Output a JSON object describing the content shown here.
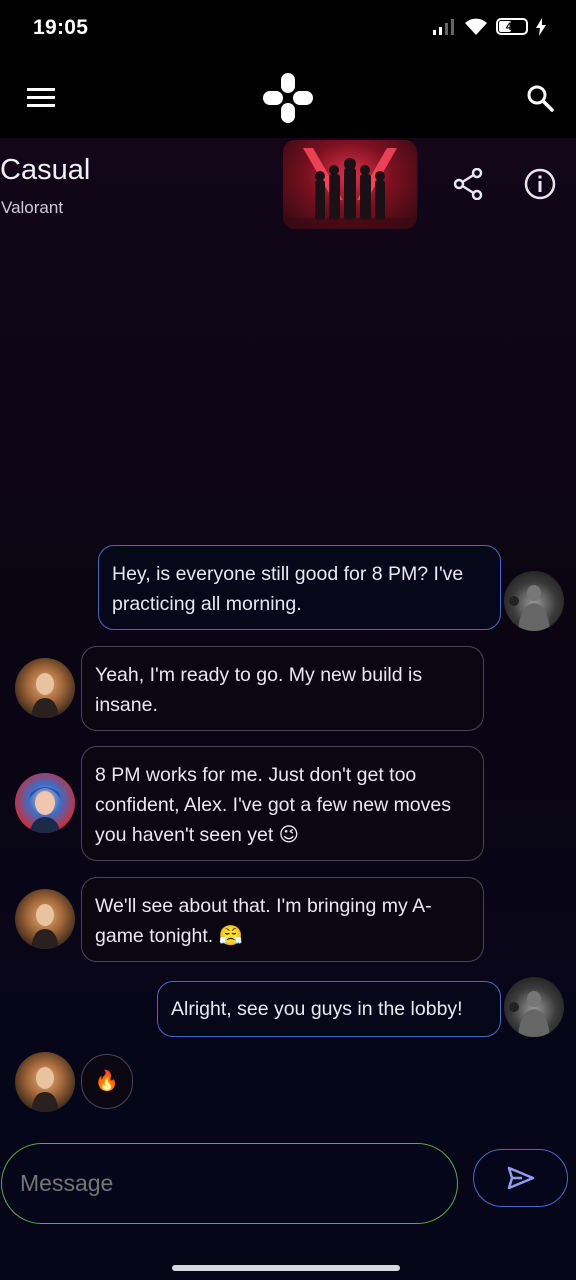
{
  "status_bar": {
    "time": "19:05",
    "battery": "43",
    "icons": [
      "signal-icon",
      "wifi-icon",
      "battery-icon",
      "charging-icon"
    ]
  },
  "app_bar": {
    "left_icon": "menu-icon",
    "center_icon": "gamepad-logo-icon",
    "right_icon": "search-icon"
  },
  "chat_header": {
    "title": "Casual",
    "subtitle": "Valorant",
    "actions": [
      "share-icon",
      "info-icon"
    ]
  },
  "messages": [
    {
      "sender": "me",
      "text": "Hey, is everyone still good for 8 PM? I've practicing all morning."
    },
    {
      "sender": "player-1",
      "text": "Yeah, I'm ready to go. My new build is insane."
    },
    {
      "sender": "player-2",
      "text": "8 PM works for me. Just don't get too confident, Alex. I've got a few new moves you haven't seen yet 😉"
    },
    {
      "sender": "player-1",
      "text": "We'll see about that. I'm bringing my A-game tonight. 😤"
    },
    {
      "sender": "me",
      "text": "Alright, see you guys in the lobby!"
    },
    {
      "sender": "player-1",
      "text": "🔥"
    }
  ],
  "composer": {
    "placeholder": "Message",
    "send_icon": "send-icon"
  },
  "colors": {
    "background": "#000000",
    "my_bubble_border": "#4a67c8",
    "their_bubble_border": "#4a4458",
    "input_border": "#5fa84a"
  }
}
